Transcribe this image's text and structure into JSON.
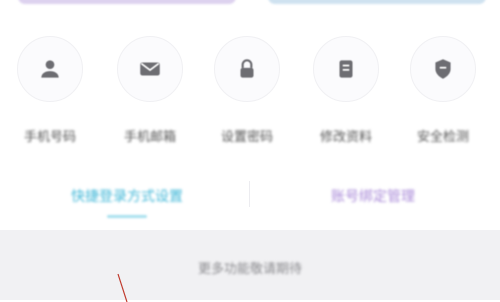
{
  "top_buttons": [
    {
      "label": "",
      "color": "#ddd2ef"
    },
    {
      "label": "",
      "color": "#cfe2f0"
    }
  ],
  "shortcuts": [
    {
      "label": "手机号码",
      "icon": "person-icon"
    },
    {
      "label": "手机邮箱",
      "icon": "mail-icon"
    },
    {
      "label": "设置密码",
      "icon": "lock-icon"
    },
    {
      "label": "修改资料",
      "icon": "document-icon"
    },
    {
      "label": "安全检测",
      "icon": "shield-icon"
    }
  ],
  "tabs": [
    {
      "label": "快捷登录方式设置",
      "color": "#43b8d8",
      "active": true
    },
    {
      "label": "账号绑定管理",
      "color": "#a98ad8",
      "active": false
    }
  ],
  "panel": {
    "title": "更多功能敬请期待"
  },
  "colors": {
    "panel_bg": "#f1f1f3",
    "annotation": "#c0392b"
  }
}
